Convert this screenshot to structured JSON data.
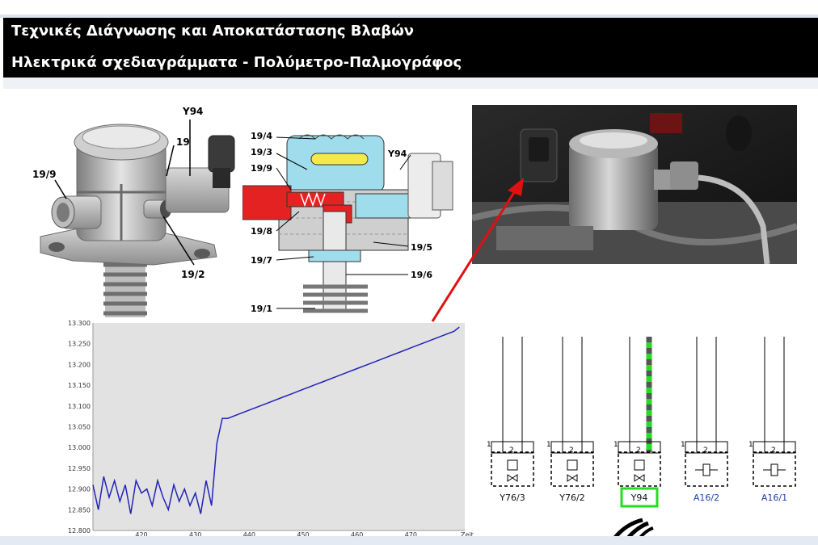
{
  "header": {
    "title": "Τεχνικές Διάγνωσης και Αποκατάστασης Βλαβών",
    "subtitle": "Ηλεκτρικά σχεδιαγράμματα - Πολύμετρο-Παλμογράφος"
  },
  "pump_labels": {
    "y94": "Y94",
    "l19": "19",
    "l19_9": "19/9",
    "l19_2": "19/2"
  },
  "section_labels": {
    "l19_4": "19/4",
    "l19_3": "19/3",
    "l19_9": "19/9",
    "l19_8": "19/8",
    "l19_7": "19/7",
    "l19_1": "19/1",
    "l19_5": "19/5",
    "l19_6": "19/6",
    "y94": "Y94"
  },
  "colors": {
    "header_bg": "#000000",
    "header_text": "#ffffff",
    "arrow": "#e01010",
    "trace": "#2323b8",
    "plot_bg": "#e2e2e2",
    "highlight": "#22dd22",
    "blue_label": "#1f3fa6"
  },
  "schematic": {
    "components": [
      {
        "label": "Y76/3",
        "color": "#111111",
        "kind": "valve"
      },
      {
        "label": "Y76/2",
        "color": "#111111",
        "kind": "valve"
      },
      {
        "label": "Y94",
        "color": "#111111",
        "kind": "valve",
        "highlighted": true
      },
      {
        "label": "A16/2",
        "color": "#1f3fa6",
        "kind": "sensor"
      },
      {
        "label": "A16/1",
        "color": "#1f3fa6",
        "kind": "sensor"
      }
    ],
    "pin1": "1",
    "pin2": "2"
  },
  "chart_data": {
    "type": "line",
    "x_ticks": [
      "420",
      "430",
      "440",
      "450",
      "460",
      "470"
    ],
    "xlabel": "Zeit [s",
    "y_ticks": [
      "12.800",
      "12.850",
      "12.900",
      "12.950",
      "13.000",
      "13.050",
      "13.100",
      "13.150",
      "13.200",
      "13.250",
      "13.300"
    ],
    "xlim": [
      411,
      480
    ],
    "ylim": [
      12.8,
      13.3
    ],
    "grid": false,
    "series": [
      {
        "x": [
          411,
          412,
          413,
          414,
          415,
          416,
          417,
          418,
          419,
          420,
          421,
          422,
          423,
          424,
          425,
          426,
          427,
          428,
          429,
          430,
          431,
          432,
          433,
          434,
          435,
          436,
          438,
          440,
          442,
          444,
          446,
          448,
          450,
          452,
          454,
          456,
          458,
          460,
          462,
          464,
          466,
          468,
          470,
          472,
          474,
          476,
          478,
          479
        ],
        "y": [
          12.91,
          12.85,
          12.93,
          12.88,
          12.92,
          12.87,
          12.91,
          12.84,
          12.92,
          12.89,
          12.9,
          12.86,
          12.92,
          12.88,
          12.85,
          12.91,
          12.87,
          12.9,
          12.86,
          12.89,
          12.84,
          12.92,
          12.86,
          13.01,
          13.07,
          13.07,
          13.08,
          13.09,
          13.1,
          13.11,
          13.12,
          13.13,
          13.14,
          13.15,
          13.16,
          13.17,
          13.18,
          13.19,
          13.2,
          13.21,
          13.22,
          13.23,
          13.24,
          13.25,
          13.26,
          13.27,
          13.28,
          13.29
        ]
      }
    ]
  }
}
